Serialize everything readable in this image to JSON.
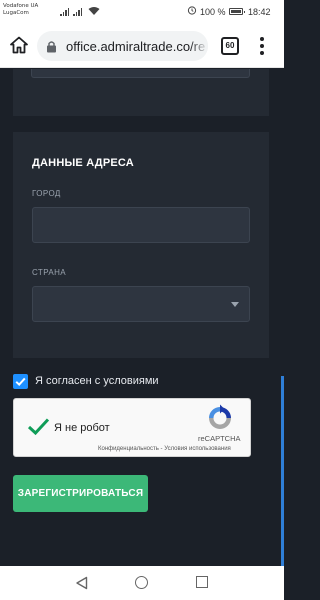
{
  "status_bar": {
    "carrier_line1": "Vodafone UA",
    "carrier_line2": "LugaCom",
    "battery_percent": "100 %",
    "time": "18:42"
  },
  "browser": {
    "url": "office.admiraltrade.co/re",
    "tab_count": "60"
  },
  "address_section": {
    "title": "ДАННЫЕ АДРЕСА",
    "city_label": "ГОРОД",
    "city_value": "",
    "country_label": "СТРАНА",
    "country_value": ""
  },
  "terms": {
    "checked": true,
    "label": "Я согласен с условиями"
  },
  "recaptcha": {
    "label": "Я не робот",
    "brand": "reCAPTCHA",
    "links": "Конфиденциальность - Условия использования"
  },
  "register_button": "ЗАРЕГИСТРИРОВАТЬСЯ",
  "colors": {
    "page_bg": "#1b2028",
    "card_bg": "#242a33",
    "accent_green": "#3cb878",
    "checkbox_blue": "#1e90ff"
  }
}
